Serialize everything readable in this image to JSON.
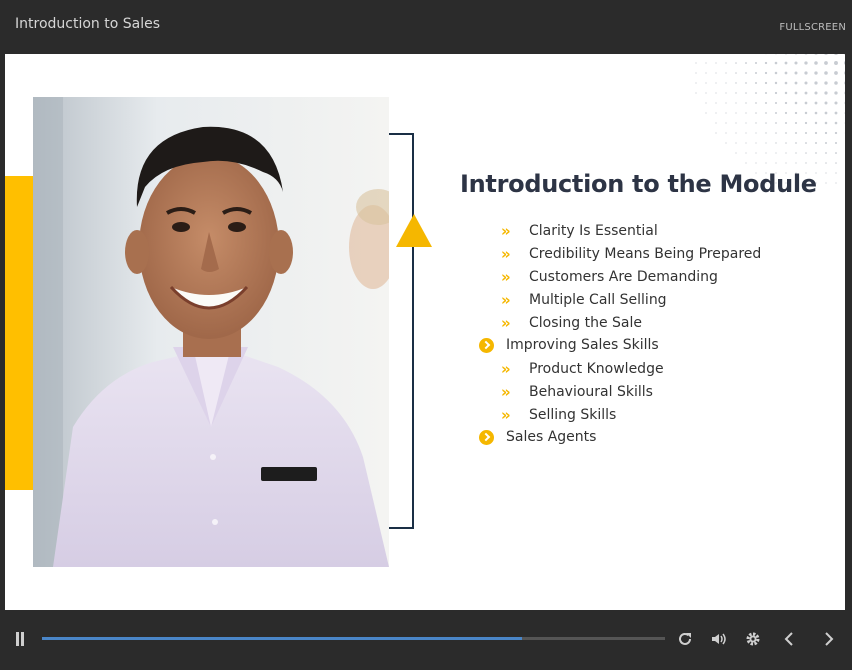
{
  "header": {
    "title": "Introduction to Sales",
    "fullscreen_label": "FULLSCREEN"
  },
  "slide": {
    "title": "Introduction to the Module",
    "accent_color": "#f5b700",
    "photo_icon": "smiling-man-photo",
    "outline": [
      {
        "label": "Clarity Is Essential",
        "level": 2
      },
      {
        "label": "Credibility Means Being Prepared",
        "level": 2
      },
      {
        "label": "Customers Are Demanding",
        "level": 2
      },
      {
        "label": "Multiple Call Selling",
        "level": 2
      },
      {
        "label": "Closing the Sale",
        "level": 2
      },
      {
        "label": "Improving Sales Skills",
        "level": 1
      },
      {
        "label": "Product Knowledge",
        "level": 2
      },
      {
        "label": "Behavioural Skills",
        "level": 2
      },
      {
        "label": "Selling Skills",
        "level": 2
      },
      {
        "label": "Sales Agents",
        "level": 1
      }
    ]
  },
  "player": {
    "progress_percent": 77,
    "progress_color": "#4a86c8",
    "icons": [
      "pause-icon",
      "replay-icon",
      "volume-icon",
      "settings-icon",
      "prev-icon",
      "next-icon"
    ]
  }
}
